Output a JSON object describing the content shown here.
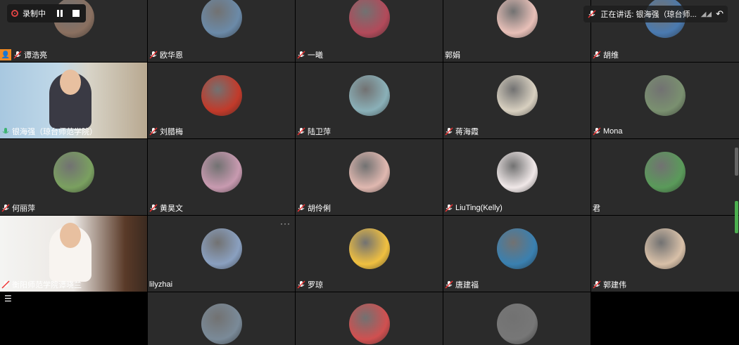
{
  "recording": {
    "label": "录制中"
  },
  "speaking": {
    "text": "正在讲话: 银海强（琼台师..."
  },
  "colors": {
    "tile_bg": "#2b2b2b",
    "accent": "#f08a24",
    "mic_green": "#3cb371"
  },
  "participants": [
    {
      "name": "谭浩亮",
      "mic": "muted",
      "badge": "host-icon"
    },
    {
      "name": "欧华恩",
      "mic": "muted"
    },
    {
      "name": "一曦",
      "mic": "muted"
    },
    {
      "name": "郭娟",
      "mic": "none"
    },
    {
      "name": "胡维",
      "mic": "muted"
    },
    {
      "name": "银海强（琼台师范学院）",
      "mic": "active"
    },
    {
      "name": "刘腊梅",
      "mic": "muted"
    },
    {
      "name": "陆卫萍",
      "mic": "muted"
    },
    {
      "name": "蒋海霞",
      "mic": "muted"
    },
    {
      "name": "Mona",
      "mic": "muted"
    },
    {
      "name": "何丽萍",
      "mic": "muted"
    },
    {
      "name": "黄昊文",
      "mic": "muted"
    },
    {
      "name": "胡伶俐",
      "mic": "muted"
    },
    {
      "name": "LiuTing(Kelly)",
      "mic": "muted"
    },
    {
      "name": "君",
      "mic": "none"
    },
    {
      "name": "衡阳师范学院谭晓兰",
      "mic": "muted"
    },
    {
      "name": "lilyzhai",
      "mic": "none"
    },
    {
      "name": "罗琼",
      "mic": "muted"
    },
    {
      "name": "唐建福",
      "mic": "muted"
    },
    {
      "name": "郭建伟",
      "mic": "muted"
    }
  ]
}
